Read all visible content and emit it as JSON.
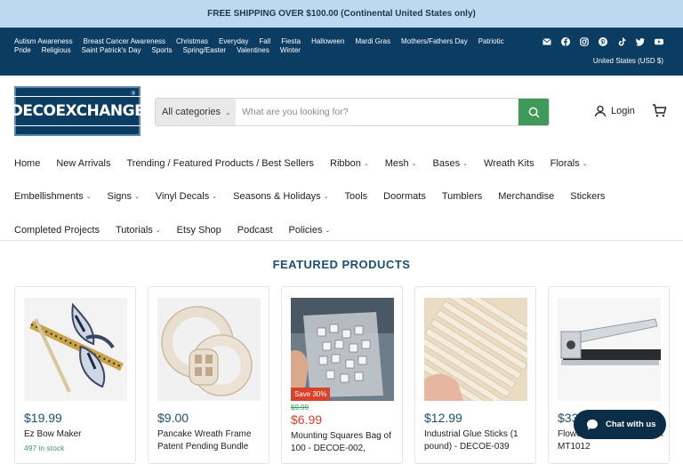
{
  "announcement": "FREE SHIPPING OVER $100.00 (Continental United States only)",
  "occasions": [
    "Autism Awareness",
    "Breast Cancer Awareness",
    "Christmas",
    "Everyday",
    "Fall",
    "Fiesta",
    "Halloween",
    "Mardi Gras",
    "Mothers/Fathers Day",
    "Patriotic",
    "Pride",
    "Religious",
    "Saint Patrick's Day",
    "Sports",
    "Spring/Easter",
    "Valentines",
    "Winter"
  ],
  "socials": [
    "mail-icon",
    "facebook-icon",
    "instagram-icon",
    "pinterest-icon",
    "tiktok-icon",
    "twitter-icon",
    "youtube-icon"
  ],
  "currency": "United States (USD $)",
  "logo": {
    "text": "DECOEXCHANGE",
    "reg": "®"
  },
  "search": {
    "category": "All categories",
    "placeholder": "What are you looking for?"
  },
  "account": {
    "login": "Login"
  },
  "nav": {
    "row1": [
      {
        "label": "Home",
        "dropdown": false
      },
      {
        "label": "New Arrivals",
        "dropdown": false
      },
      {
        "label": "Trending / Featured Products / Best Sellers",
        "dropdown": false
      },
      {
        "label": "Ribbon",
        "dropdown": true
      },
      {
        "label": "Mesh",
        "dropdown": true
      },
      {
        "label": "Bases",
        "dropdown": true
      },
      {
        "label": "Wreath Kits",
        "dropdown": false
      },
      {
        "label": "Florals",
        "dropdown": true
      }
    ],
    "row2": [
      {
        "label": "Embellishments",
        "dropdown": true
      },
      {
        "label": "Signs",
        "dropdown": true
      },
      {
        "label": "Vinyl Decals",
        "dropdown": true
      },
      {
        "label": "Seasons & Holidays",
        "dropdown": true
      },
      {
        "label": "Tools",
        "dropdown": false
      },
      {
        "label": "Doormats",
        "dropdown": false
      },
      {
        "label": "Tumblers",
        "dropdown": false
      },
      {
        "label": "Merchandise",
        "dropdown": false
      },
      {
        "label": "Stickers",
        "dropdown": false
      }
    ],
    "row3": [
      {
        "label": "Completed Projects",
        "dropdown": false
      },
      {
        "label": "Tutorials",
        "dropdown": true
      },
      {
        "label": "Etsy Shop",
        "dropdown": false
      },
      {
        "label": "Podcast",
        "dropdown": false
      },
      {
        "label": "Policies",
        "dropdown": true
      }
    ]
  },
  "featured": {
    "title": "FEATURED PRODUCTS",
    "products": [
      {
        "price": "$19.99",
        "title": "Ez Bow Maker",
        "stock": "497 in stock"
      },
      {
        "price": "$9.00",
        "title": "Pancake Wreath Frame Patent Pending Bundle"
      },
      {
        "was": "$9.99",
        "price": "$6.99",
        "title": "Mounting Squares Bag of 100 - DECOE-002,",
        "badge": "Save 30%"
      },
      {
        "price": "$12.99",
        "title": "Industrial Glue Sticks (1 pound) - DECOE-039"
      },
      {
        "price": "$33",
        "title": "Flower Cutter\" Silver/Black MT1012"
      }
    ]
  },
  "chat": {
    "label": "Chat with us"
  },
  "colors": {
    "announce_bg": "#bcd9ef",
    "brand_navy": "#0b3c61",
    "accent_green": "#3f9a59",
    "price_blue": "#1b4f7a",
    "sale_red": "#d9412b"
  }
}
